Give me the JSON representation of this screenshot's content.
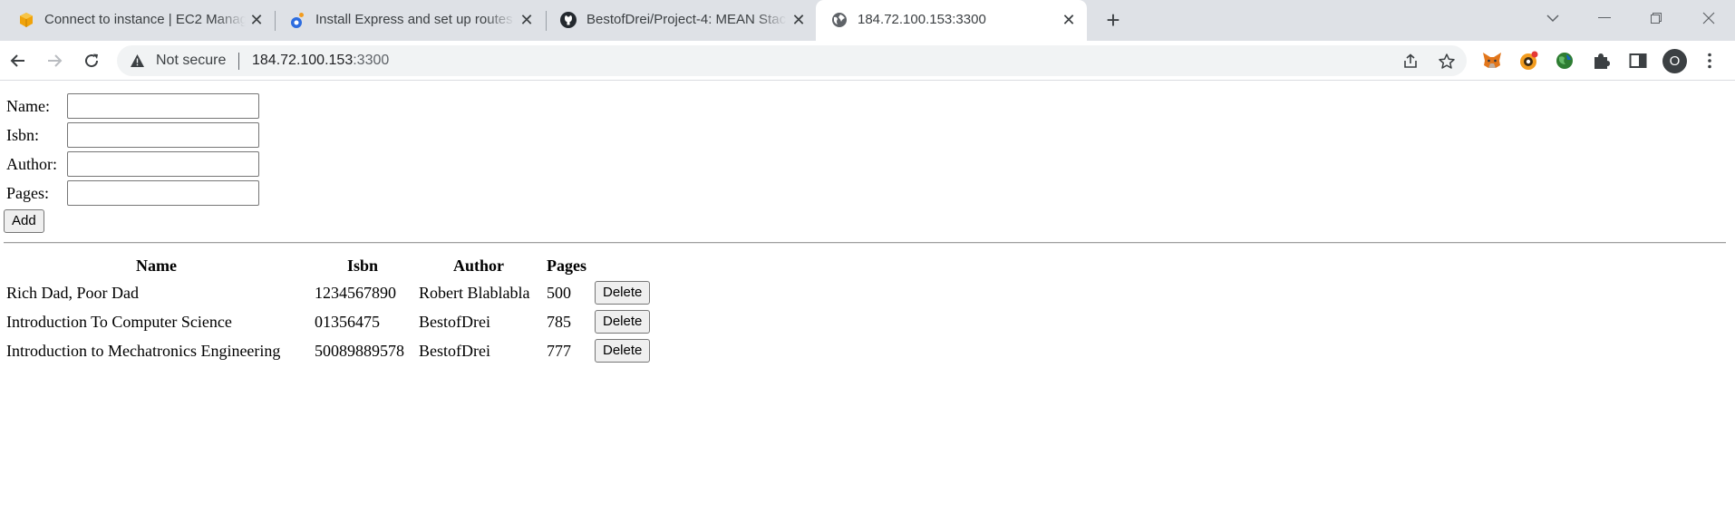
{
  "browser": {
    "tabs": [
      {
        "title": "Connect to instance | EC2 Manag",
        "icon": "aws-box-icon",
        "active": false
      },
      {
        "title": "Install Express and set up routes",
        "icon": "blue-flame-icon",
        "active": false
      },
      {
        "title": "BestofDrei/Project-4: MEAN Stac",
        "icon": "github-icon",
        "active": false
      },
      {
        "title": "184.72.100.153:3300",
        "icon": "globe-icon",
        "active": true
      }
    ],
    "new_tab": "+",
    "address": {
      "security_text": "Not secure",
      "host": "184.72.100.153",
      "port": ":3300"
    },
    "profile_initial": "O"
  },
  "form": {
    "fields": [
      {
        "label": "Name:",
        "value": ""
      },
      {
        "label": "Isbn:",
        "value": ""
      },
      {
        "label": "Author:",
        "value": ""
      },
      {
        "label": "Pages:",
        "value": ""
      }
    ],
    "add_label": "Add"
  },
  "table": {
    "headers": [
      "Name",
      "Isbn",
      "Author",
      "Pages"
    ],
    "rows": [
      {
        "name": "Rich Dad, Poor Dad",
        "isbn": "1234567890",
        "author": "Robert Blablabla",
        "pages": "500",
        "action": "Delete"
      },
      {
        "name": "Introduction To Computer Science",
        "isbn": "01356475",
        "author": "BestofDrei",
        "pages": "785",
        "action": "Delete"
      },
      {
        "name": "Introduction to Mechatronics Engineering",
        "isbn": "50089889578",
        "author": "BestofDrei",
        "pages": "777",
        "action": "Delete"
      }
    ]
  }
}
